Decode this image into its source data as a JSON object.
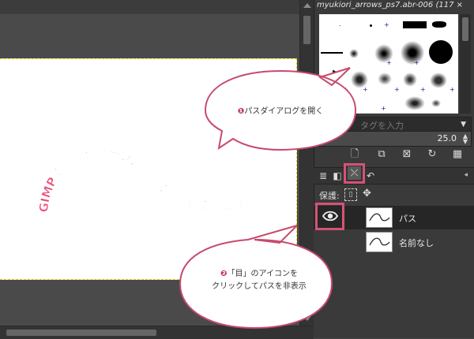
{
  "brushes": {
    "title": "myukiori_arrows_ps7.abr-006 (117 ×",
    "filter_hint": "タグを入力",
    "spacing_value": "25.0"
  },
  "tabs": {
    "items": [
      {
        "name": "layers-tab",
        "glyph": "≣"
      },
      {
        "name": "channels-tab",
        "glyph": "◧"
      },
      {
        "name": "paths-tab",
        "glyph": "⤫"
      },
      {
        "name": "undo-tab",
        "glyph": "↶"
      }
    ]
  },
  "lock": {
    "label": "保護:"
  },
  "paths": {
    "items": [
      {
        "name": "パス",
        "selected": true,
        "visible": true
      },
      {
        "name": "名前なし",
        "selected": false,
        "visible": false
      }
    ]
  },
  "canvas": {
    "curved_text": "GIMPで文字をカーブに沿って配置してみよう"
  },
  "callouts": {
    "one_number": "❶",
    "one_text": "パスダイアログを開く",
    "two_number": "❷",
    "two_line1": "「目」のアイコンを",
    "two_line2": "クリックしてパスを非表示"
  },
  "colors": {
    "accent": "#d55376",
    "curve_text": "#ea5078",
    "canvas_selection": "#e6d600"
  }
}
